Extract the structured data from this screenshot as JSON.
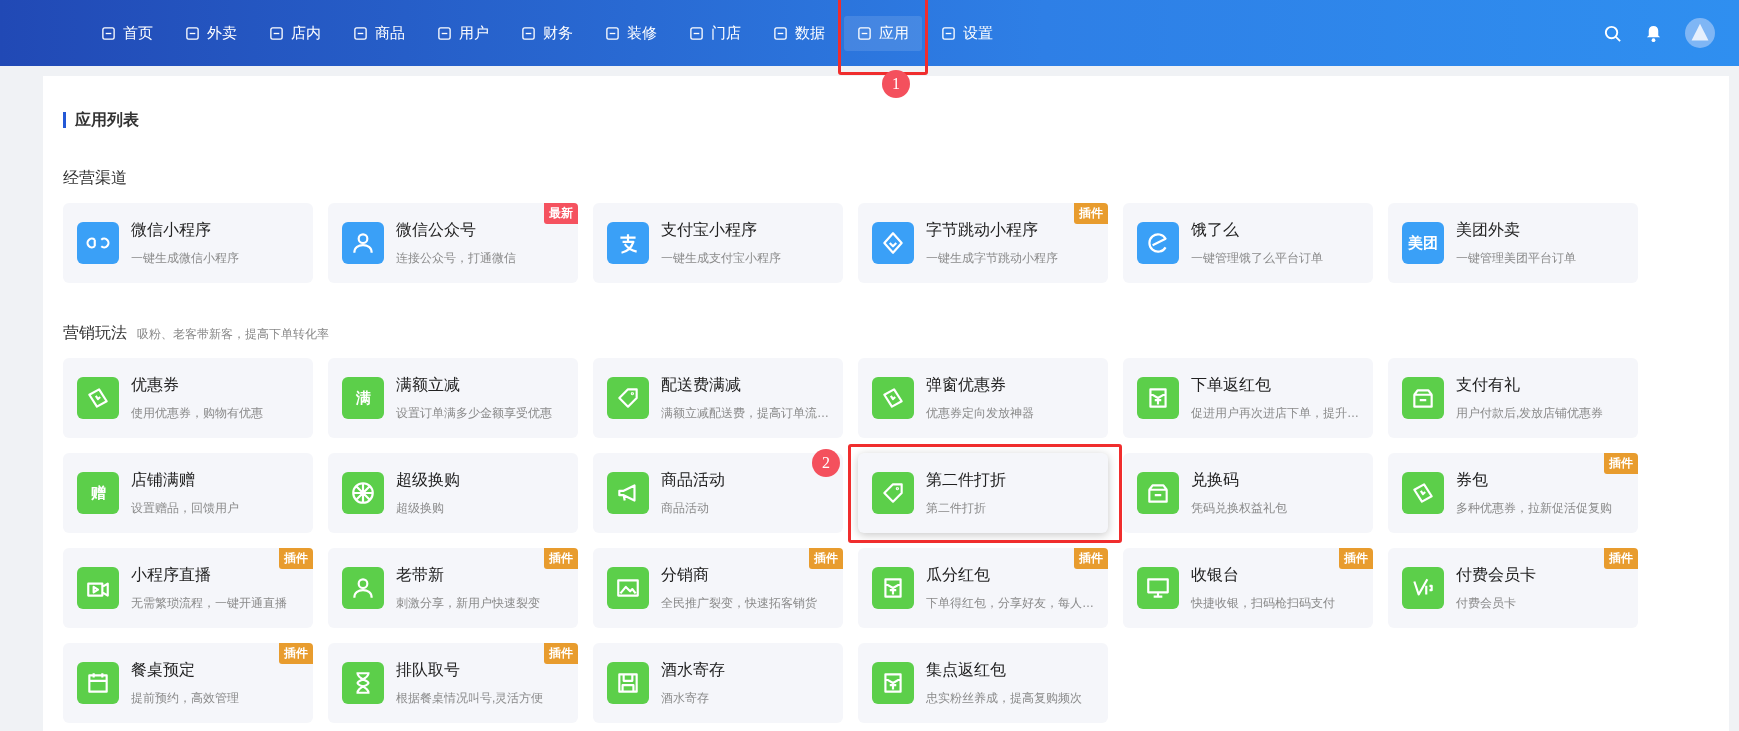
{
  "nav": {
    "items": [
      {
        "label": "首页",
        "selected": false
      },
      {
        "label": "外卖",
        "selected": false
      },
      {
        "label": "店内",
        "selected": false
      },
      {
        "label": "商品",
        "selected": false
      },
      {
        "label": "用户",
        "selected": false
      },
      {
        "label": "财务",
        "selected": false
      },
      {
        "label": "装修",
        "selected": false
      },
      {
        "label": "门店",
        "selected": false
      },
      {
        "label": "数据",
        "selected": false
      },
      {
        "label": "应用",
        "selected": true,
        "callout": "1"
      },
      {
        "label": "设置",
        "selected": false
      }
    ]
  },
  "page_title": "应用列表",
  "sections": [
    {
      "title": "经营渠道",
      "color": "#3aa0f7",
      "cards": [
        {
          "title": "微信小程序",
          "desc": "一键生成微信小程序",
          "selected": false
        },
        {
          "title": "微信公众号",
          "desc": "连接公众号，打通微信",
          "selected": false,
          "badge": {
            "text": "最新",
            "color": "#f5525f"
          }
        },
        {
          "title": "支付宝小程序",
          "desc": "一键生成支付宝小程序",
          "selected": false
        },
        {
          "title": "字节跳动小程序",
          "desc": "一键生成字节跳动小程序",
          "selected": false,
          "badge": {
            "text": "插件",
            "color": "#e89c2e"
          }
        },
        {
          "title": "饿了么",
          "desc": "一键管理饿了么平台订单",
          "selected": false
        },
        {
          "title": "美团外卖",
          "desc": "一键管理美团平台订单",
          "selected": false,
          "icon_text": "美团"
        }
      ]
    },
    {
      "title": "营销玩法",
      "subtitle": "吸粉、老客带新客，提高下单转化率",
      "color": "#5ccf4a",
      "cards": [
        {
          "title": "优惠券",
          "desc": "使用优惠券，购物有优惠",
          "selected": false
        },
        {
          "title": "满额立减",
          "desc": "设置订单满多少金额享受优惠",
          "selected": false,
          "icon_text": "满"
        },
        {
          "title": "配送费满减",
          "desc": "满额立减配送费，提高订单流…",
          "selected": false
        },
        {
          "title": "弹窗优惠券",
          "desc": "优惠券定向发放神器",
          "selected": false
        },
        {
          "title": "下单返红包",
          "desc": "促进用户再次进店下单，提升…",
          "selected": false
        },
        {
          "title": "支付有礼",
          "desc": "用户付款后,发放店铺优惠券",
          "selected": false
        },
        {
          "title": "店铺满赠",
          "desc": "设置赠品，回馈用户",
          "selected": false,
          "icon_text": "赠"
        },
        {
          "title": "超级换购",
          "desc": "超级换购",
          "selected": false
        },
        {
          "title": "商品活动",
          "desc": "商品活动",
          "selected": false
        },
        {
          "title": "第二件打折",
          "desc": "第二件打折",
          "selected": true,
          "callout": "2"
        },
        {
          "title": "兑换码",
          "desc": "凭码兑换权益礼包",
          "selected": false
        },
        {
          "title": "券包",
          "desc": "多种优惠券，拉新促活促复购",
          "selected": false,
          "badge": {
            "text": "插件",
            "color": "#e89c2e"
          }
        },
        {
          "title": "小程序直播",
          "desc": "无需繁琐流程，一键开通直播",
          "selected": false,
          "badge": {
            "text": "插件",
            "color": "#e89c2e"
          }
        },
        {
          "title": "老带新",
          "desc": "刺激分享，新用户快速裂变",
          "selected": false,
          "badge": {
            "text": "插件",
            "color": "#e89c2e"
          }
        },
        {
          "title": "分销商",
          "desc": "全民推广裂变，快速拓客销货",
          "selected": false,
          "badge": {
            "text": "插件",
            "color": "#e89c2e"
          }
        },
        {
          "title": "瓜分红包",
          "desc": "下单得红包，分享好友，每人…",
          "selected": false,
          "badge": {
            "text": "插件",
            "color": "#e89c2e"
          }
        },
        {
          "title": "收银台",
          "desc": "快捷收银，扫码枪扫码支付",
          "selected": false,
          "badge": {
            "text": "插件",
            "color": "#e89c2e"
          }
        },
        {
          "title": "付费会员卡",
          "desc": "付费会员卡",
          "selected": false,
          "badge": {
            "text": "插件",
            "color": "#e89c2e"
          }
        },
        {
          "title": "餐桌预定",
          "desc": "提前预约，高效管理",
          "selected": false,
          "badge": {
            "text": "插件",
            "color": "#e89c2e"
          }
        },
        {
          "title": "排队取号",
          "desc": "根据餐桌情况叫号,灵活方便",
          "selected": false,
          "badge": {
            "text": "插件",
            "color": "#e89c2e"
          }
        },
        {
          "title": "酒水寄存",
          "desc": "酒水寄存",
          "selected": false
        },
        {
          "title": "集点返红包",
          "desc": "忠实粉丝养成，提高复购频次",
          "selected": false
        }
      ]
    }
  ]
}
